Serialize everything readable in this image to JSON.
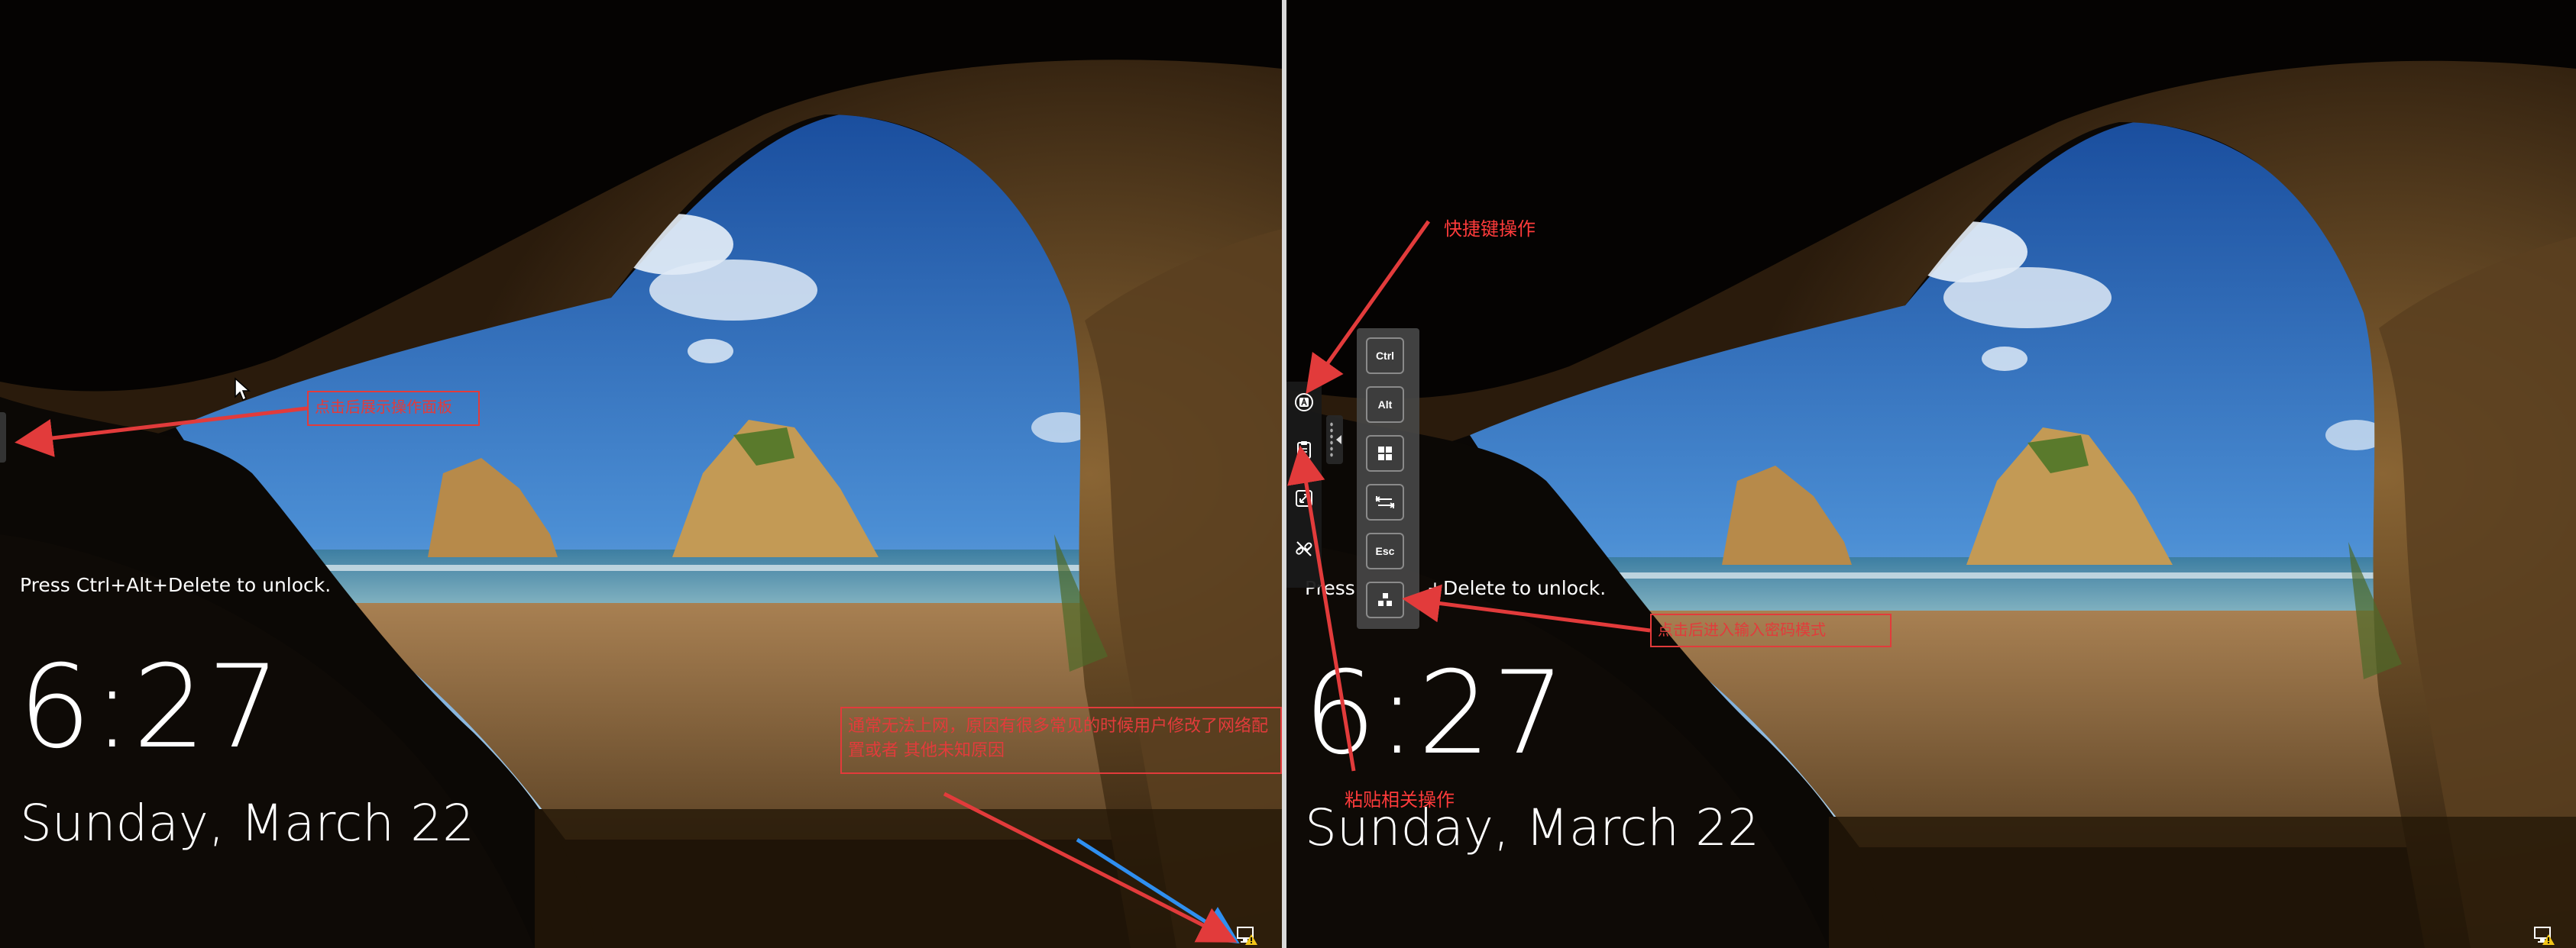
{
  "lock_screen": {
    "hint": "Press Ctrl+Alt+Delete to unlock.",
    "time": "6:27",
    "date": "Sunday, March 22",
    "hint_right_left": "Press ",
    "hint_right_right": "+Delete to unlock."
  },
  "annotations": {
    "left_edge_callout": "点击后展示操作面板",
    "network_callout": "通常无法上网，原因有很多常见的时候用户修改了网络配置或者 其他未知原因",
    "shortcut_label": "快捷键操作",
    "paste_label": "粘贴相关操作",
    "password_callout": "点击后进入输入密码模式"
  },
  "shortcut_keys": [
    "Ctrl",
    "Alt",
    "win-logo-icon",
    "tab-icon",
    "Esc",
    "password-mode-icon"
  ],
  "colors": {
    "annotation_red": "#e23b3b",
    "arrow_blue": "#2f8ff0",
    "sky_blue": "#2c6fc0",
    "sand": "#b68a50",
    "rock": "#7a5a32"
  }
}
